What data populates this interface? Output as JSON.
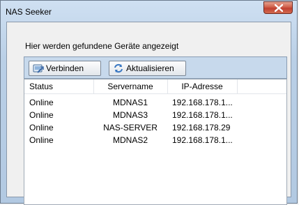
{
  "window": {
    "title": "NAS Seeker"
  },
  "heading": "Hier werden gefundene Geräte angezeigt",
  "toolbar": {
    "connect_label": "Verbinden",
    "refresh_label": "Aktualisieren"
  },
  "table": {
    "columns": [
      "Status",
      "Servername",
      "IP-Adresse"
    ],
    "rows": [
      {
        "status": "Online",
        "server": "MDNAS1",
        "ip": "192.168.178.1..."
      },
      {
        "status": "Online",
        "server": "MDNAS3",
        "ip": "192.168.178.1..."
      },
      {
        "status": "Online",
        "server": "NAS-SERVER",
        "ip": "192.168.178.29"
      },
      {
        "status": "Online",
        "server": "MDNAS2",
        "ip": "192.168.178.1..."
      }
    ]
  },
  "icons": {
    "close": "close-icon",
    "connect": "connect-icon",
    "refresh": "refresh-icon"
  }
}
